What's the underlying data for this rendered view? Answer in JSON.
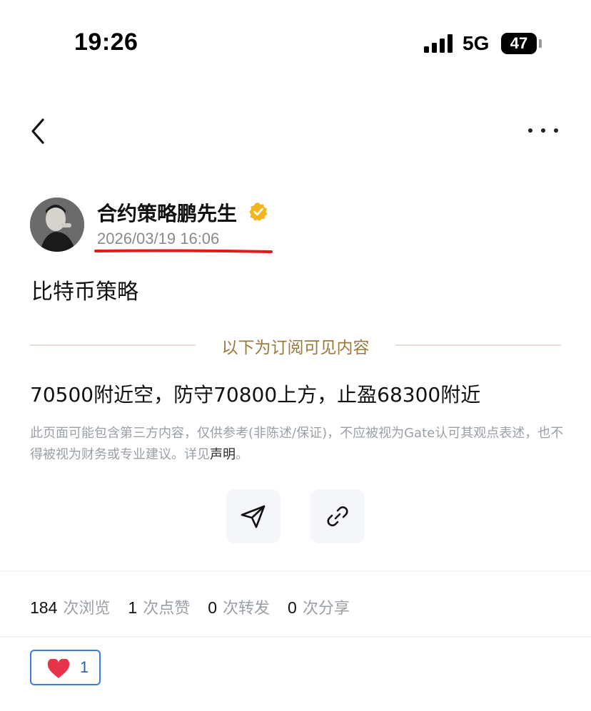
{
  "status_bar": {
    "time": "19:26",
    "network": "5G",
    "battery": "47"
  },
  "header": {
    "back_icon": "chevron-left-icon",
    "more_icon": "more-horizontal-icon"
  },
  "author": {
    "name": "合约策略鹏先生",
    "verified_icon": "verified-badge-icon",
    "post_time": "2026/03/19 16:06",
    "highlight_color": "#e21a1a"
  },
  "post": {
    "title": "比特币策略",
    "subscribe_divider_label": "以下为订阅可见内容",
    "body": "70500附近空，防守70800上方，止盈68300附近",
    "disclaimer_text": "此页面可能包含第三方内容，仅供参考(非陈述/保证)，不应被视为Gate认可其观点表述，也不得被视为财务或专业建议。详见",
    "disclaimer_link": "声明",
    "disclaimer_end": "。"
  },
  "actions": {
    "telegram_icon": "paper-plane-icon",
    "link_icon": "link-icon"
  },
  "stats": [
    {
      "value": "184",
      "label": "次浏览"
    },
    {
      "value": "1",
      "label": "次点赞"
    },
    {
      "value": "0",
      "label": "次转发"
    },
    {
      "value": "0",
      "label": "次分享"
    }
  ],
  "reaction": {
    "icon": "heart-icon",
    "count": "1",
    "accent": "#3a7fd8",
    "heart_color": "#e8344a"
  },
  "colors": {
    "gold": "#9c7a3b",
    "muted": "#9aa0a6"
  }
}
